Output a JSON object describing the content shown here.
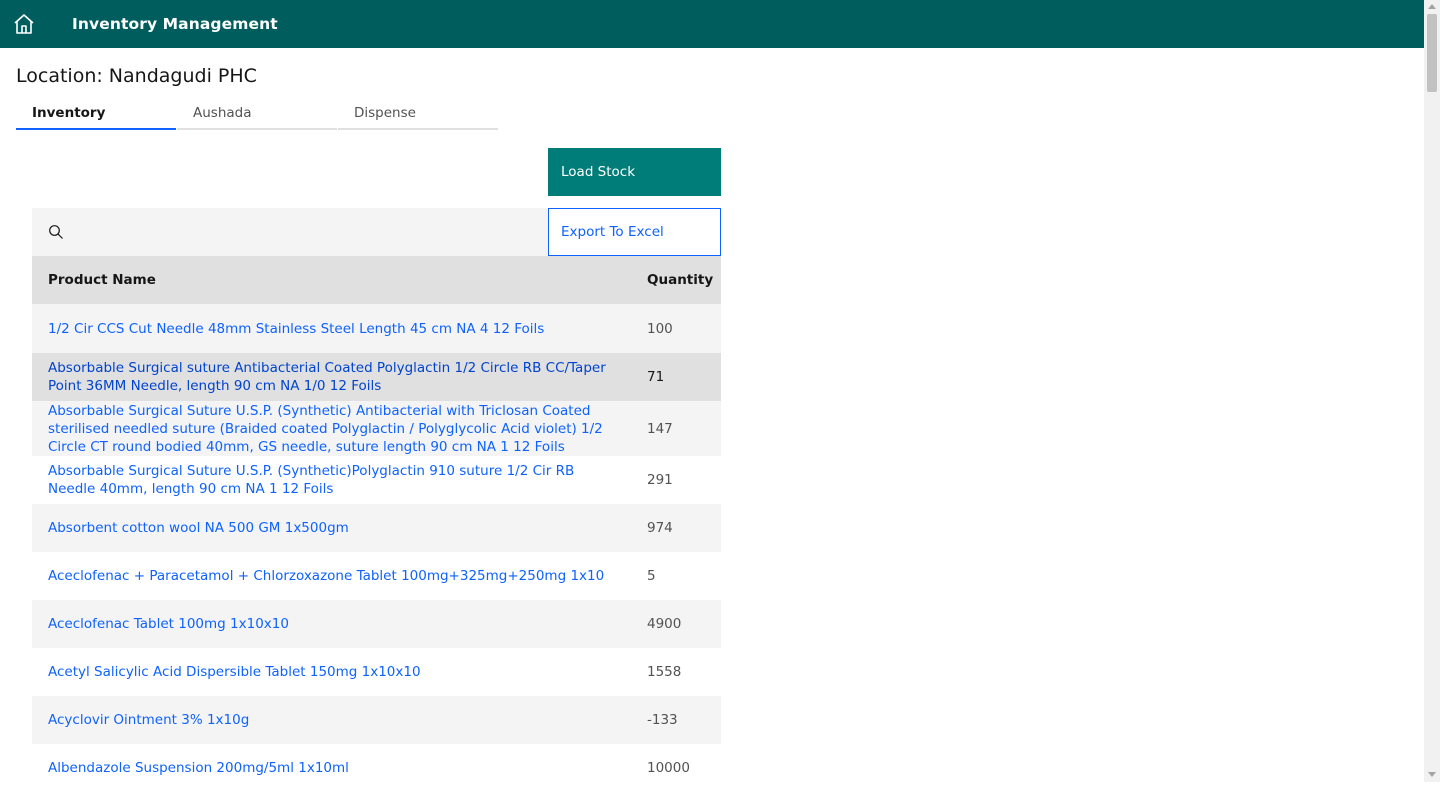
{
  "header": {
    "title": "Inventory Management",
    "home_icon": "home-icon"
  },
  "location_label": "Location: Nandagudi PHC",
  "tabs": [
    {
      "label": "Inventory",
      "active": true
    },
    {
      "label": "Aushada",
      "active": false
    },
    {
      "label": "Dispense",
      "active": false
    }
  ],
  "actions": {
    "load_stock": "Load Stock",
    "export": "Export To Excel"
  },
  "search": {
    "placeholder": "",
    "icon": "search-icon"
  },
  "table": {
    "columns": [
      "Product Name",
      "Quantity"
    ],
    "rows": [
      {
        "name": "1/2 Cir CCS Cut Needle 48mm Stainless Steel Length 45 cm NA 4 12 Foils",
        "qty": "100"
      },
      {
        "name": "Absorbable Surgical suture Antibacterial Coated Polyglactin 1/2 Circle RB CC/Taper Point 36MM Needle, length 90 cm NA 1/0 12 Foils",
        "qty": "71"
      },
      {
        "name": "Absorbable Surgical Suture U.S.P. (Synthetic) Antibacterial with Triclosan Coated sterilised needled suture (Braided coated Polyglactin / Polyglycolic Acid violet) 1/2 Circle CT round bodied 40mm, GS needle, suture length 90 cm NA 1 12 Foils",
        "qty": "147"
      },
      {
        "name": "Absorbable Surgical Suture U.S.P. (Synthetic)Polyglactin 910 suture 1/2 Cir RB Needle 40mm, length 90 cm NA 1 12 Foils",
        "qty": "291"
      },
      {
        "name": "Absorbent cotton wool NA 500 GM 1x500gm",
        "qty": "974"
      },
      {
        "name": "Aceclofenac + Paracetamol + Chlorzoxazone Tablet 100mg+325mg+250mg 1x10",
        "qty": "5"
      },
      {
        "name": "Aceclofenac Tablet 100mg 1x10x10",
        "qty": "4900"
      },
      {
        "name": "Acetyl Salicylic Acid Dispersible Tablet 150mg 1x10x10",
        "qty": "1558"
      },
      {
        "name": "Acyclovir Ointment 3% 1x10g",
        "qty": "-133"
      },
      {
        "name": "Albendazole Suspension 200mg/5ml 1x10ml",
        "qty": "10000"
      }
    ]
  },
  "colors": {
    "header_bg": "#005d5d",
    "primary_button": "#007d79",
    "link": "#0f62fe"
  }
}
